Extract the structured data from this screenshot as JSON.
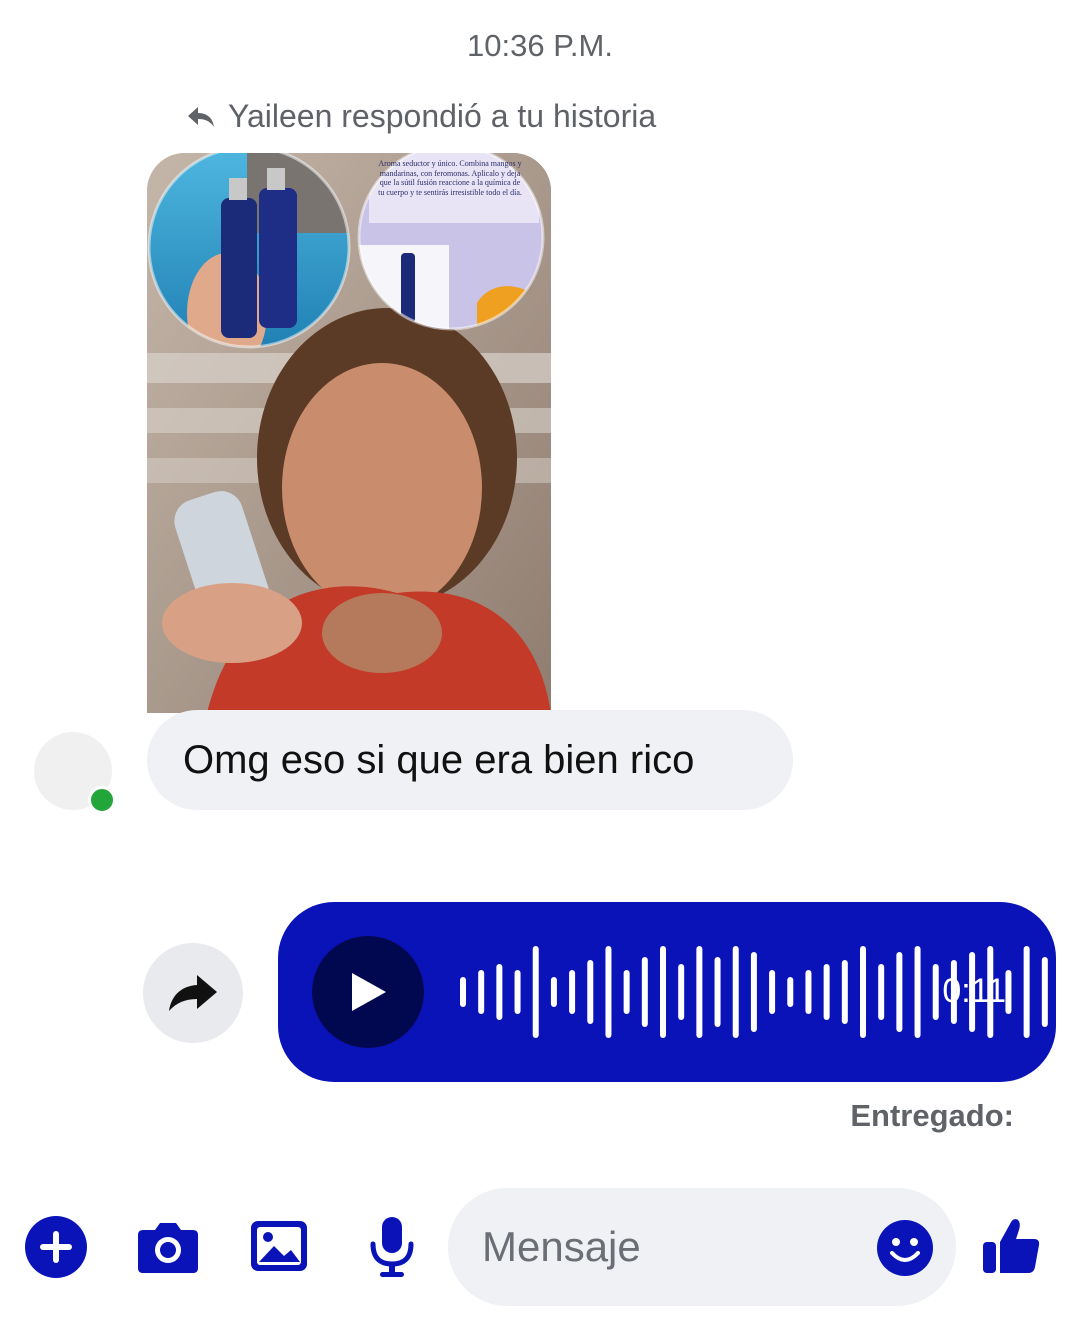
{
  "conversation": {
    "timestamp": "10:36 P.M.",
    "reply_note": "Yaileen respondió a tu historia"
  },
  "story": {
    "caption": "Aroma seductor y único. Combina mangos y mandarinas, con feromonas. Aplicalo y deja que la sútil fusión reaccione a la química de tu cuerpo y te sentirás irresistible todo el día."
  },
  "incoming_message": {
    "text": "Omg eso si que era bien rico"
  },
  "audio_message": {
    "duration": "0:11"
  },
  "status": {
    "text": "Entregado:"
  },
  "composer": {
    "placeholder": "Mensaje"
  },
  "colors": {
    "accent": "#0a13b8",
    "bubble_gray": "#eff1f4",
    "online": "#22a63a"
  },
  "icons": [
    "reply-icon",
    "forward-icon",
    "play-icon",
    "plus-icon",
    "camera-icon",
    "gallery-icon",
    "microphone-icon",
    "emoji-icon",
    "thumbs-up-icon"
  ]
}
